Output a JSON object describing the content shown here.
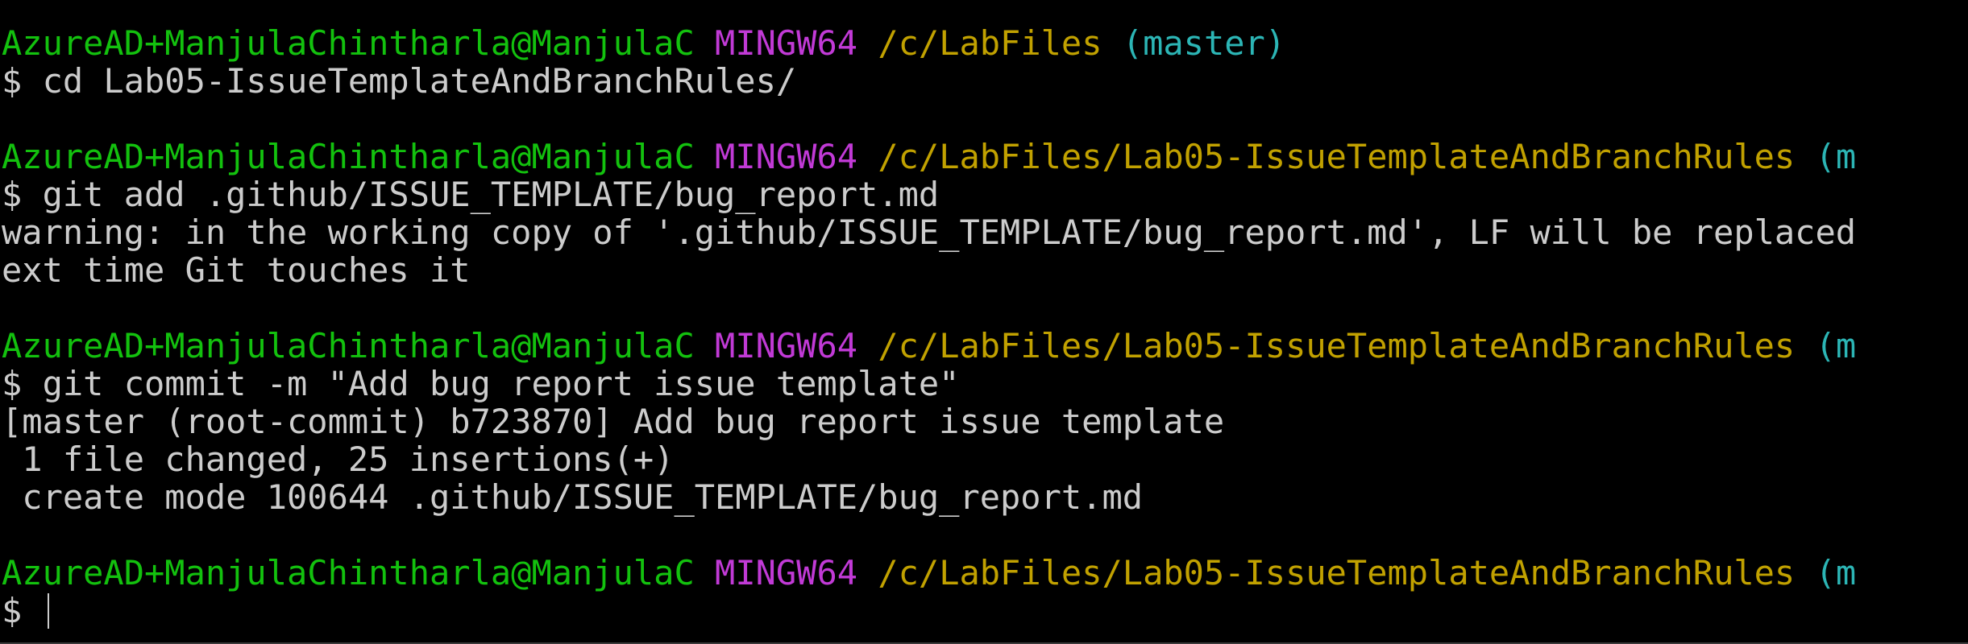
{
  "terminal": {
    "colors": {
      "background": "#000000",
      "user": "#13c10e",
      "env": "#c13ad6",
      "path": "#c1a100",
      "branch": "#2cb5b5",
      "text": "#cccccc"
    },
    "blocks": [
      {
        "prompt": {
          "user": "AzureAD+ManjulaChintharla@ManjulaC",
          "env": "MINGW64",
          "path": "/c/LabFiles",
          "branch": "(master)"
        },
        "command": "$ cd Lab05-IssueTemplateAndBranchRules/",
        "output": []
      },
      {
        "prompt": {
          "user": "AzureAD+ManjulaChintharla@ManjulaC",
          "env": "MINGW64",
          "path": "/c/LabFiles/Lab05-IssueTemplateAndBranchRules",
          "branch": "(m"
        },
        "command": "$ git add .github/ISSUE_TEMPLATE/bug_report.md",
        "output": [
          "warning: in the working copy of '.github/ISSUE_TEMPLATE/bug_report.md', LF will be replaced",
          "ext time Git touches it"
        ]
      },
      {
        "prompt": {
          "user": "AzureAD+ManjulaChintharla@ManjulaC",
          "env": "MINGW64",
          "path": "/c/LabFiles/Lab05-IssueTemplateAndBranchRules",
          "branch": "(m"
        },
        "command": "$ git commit -m \"Add bug report issue template\"",
        "output": [
          "[master (root-commit) b723870] Add bug report issue template",
          " 1 file changed, 25 insertions(+)",
          " create mode 100644 .github/ISSUE_TEMPLATE/bug_report.md"
        ]
      },
      {
        "prompt": {
          "user": "AzureAD+ManjulaChintharla@ManjulaC",
          "env": "MINGW64",
          "path": "/c/LabFiles/Lab05-IssueTemplateAndBranchRules",
          "branch": "(m"
        },
        "command": "$ ",
        "output": []
      }
    ]
  }
}
